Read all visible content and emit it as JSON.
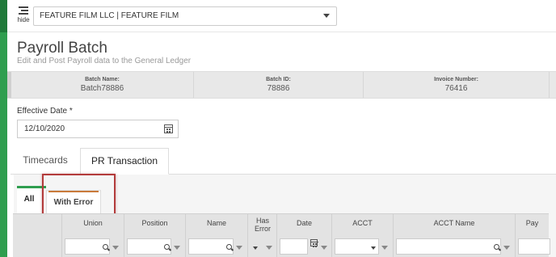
{
  "topbar": {
    "hide_label": "hide",
    "company": "FEATURE FILM LLC | FEATURE FILM"
  },
  "page": {
    "title": "Payroll Batch",
    "subtitle": "Edit and Post Payroll data to the General Ledger"
  },
  "batch": {
    "name_label": "Batch Name:",
    "name_value": "Batch78886",
    "id_label": "Batch ID:",
    "id_value": "78886",
    "invoice_label": "Invoice Number:",
    "invoice_value": "76416"
  },
  "effective_date": {
    "label": "Effective Date *",
    "value": "12/10/2020"
  },
  "main_tabs": [
    {
      "label": "Timecards",
      "active": false
    },
    {
      "label": "PR Transaction",
      "active": true
    }
  ],
  "sub_tabs": [
    {
      "label": "All",
      "active": true
    },
    {
      "label": "With Error",
      "active": false
    }
  ],
  "columns": [
    {
      "label": "Union"
    },
    {
      "label": "Position"
    },
    {
      "label": "Name"
    },
    {
      "label": "Has Error"
    },
    {
      "label": "Date"
    },
    {
      "label": "ACCT"
    },
    {
      "label": "ACCT Name"
    },
    {
      "label": "Pay"
    }
  ],
  "colors": {
    "accent_green": "#2f9e4f",
    "highlight_red": "#b33b3b"
  }
}
